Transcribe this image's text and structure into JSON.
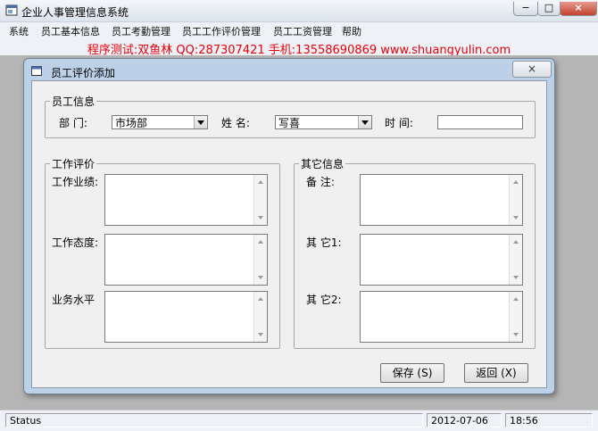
{
  "app": {
    "title": "企业人事管理信息系统"
  },
  "window_controls": {
    "min": "−",
    "max": "□",
    "close": "×"
  },
  "menu": [
    {
      "label": "系统"
    },
    {
      "label": "员工基本信息"
    },
    {
      "label": "员工考勤管理"
    },
    {
      "label": "员工工作评价管理"
    },
    {
      "label": "员工工资管理"
    },
    {
      "label": "帮助"
    }
  ],
  "banner": "程序测试:双鱼林 QQ:287307421 手机:13558690869 www.shuangyulin.com",
  "dialog": {
    "title": "员工评价添加",
    "close": "×",
    "employee_group": {
      "legend": "员工信息",
      "dept_label": "部    门:",
      "dept_value": "市场部",
      "name_label": "姓    名:",
      "name_value": "写喜",
      "time_label": "时    间:",
      "time_value": ""
    },
    "eval_group": {
      "legend": "工作评价",
      "performance_label": "工作业绩:",
      "attitude_label": "工作态度:",
      "skill_label": "业务水平"
    },
    "other_group": {
      "legend": "其它信息",
      "remark_label": "备    注:",
      "other1_label": "其    它1:",
      "other2_label": "其    它2:"
    },
    "save_button": "保存 (S)",
    "back_button": "返回 (X)"
  },
  "status": {
    "text": "Status",
    "date": "2012-07-06",
    "time": "18:56"
  }
}
